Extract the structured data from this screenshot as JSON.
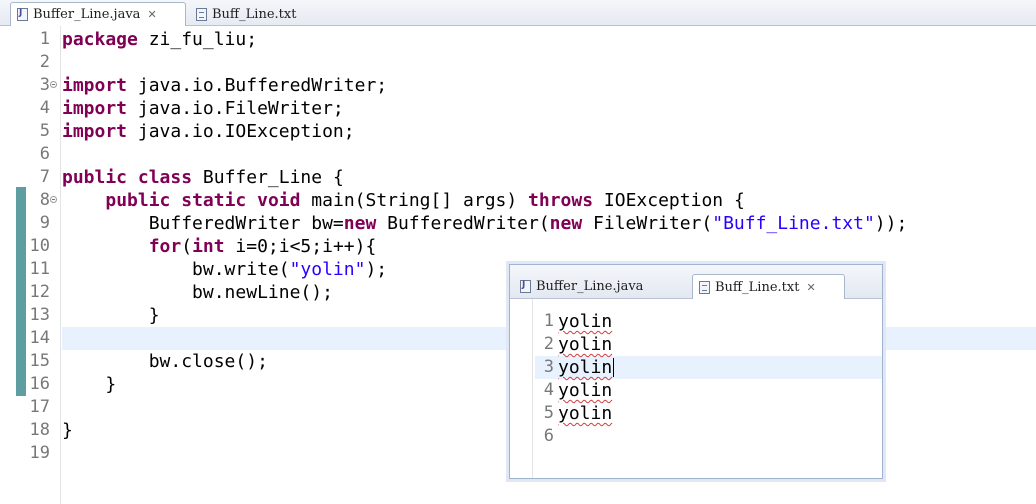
{
  "editor": {
    "tabs": [
      {
        "label": "Buffer_Line.java",
        "active": true,
        "icon": "java-file-icon"
      },
      {
        "label": "Buff_Line.txt",
        "active": false,
        "icon": "text-file-icon"
      }
    ],
    "line_numbers": [
      "1",
      "2",
      "3",
      "4",
      "5",
      "6",
      "7",
      "8",
      "9",
      "10",
      "11",
      "12",
      "13",
      "14",
      "15",
      "16",
      "17",
      "18",
      "19"
    ],
    "current_line": 14,
    "colors": {
      "keyword": "#7f0055",
      "string": "#2a00ff",
      "current_line": "#e8f2fe",
      "change_marker": "#5e9ea0"
    },
    "lines": [
      [
        {
          "k": "kw",
          "t": "package"
        },
        {
          "t": " zi_fu_liu;"
        }
      ],
      [],
      [
        {
          "k": "kw",
          "t": "import"
        },
        {
          "t": " java.io.BufferedWriter;"
        }
      ],
      [
        {
          "k": "kw",
          "t": "import"
        },
        {
          "t": " java.io.FileWriter;"
        }
      ],
      [
        {
          "k": "kw",
          "t": "import"
        },
        {
          "t": " java.io.IOException;"
        }
      ],
      [],
      [
        {
          "k": "kw",
          "t": "public"
        },
        {
          "t": " "
        },
        {
          "k": "kw",
          "t": "class"
        },
        {
          "t": " Buffer_Line {"
        }
      ],
      [
        {
          "t": "    "
        },
        {
          "k": "kw",
          "t": "public"
        },
        {
          "t": " "
        },
        {
          "k": "kw",
          "t": "static"
        },
        {
          "t": " "
        },
        {
          "k": "kw",
          "t": "void"
        },
        {
          "t": " main(String[] args) "
        },
        {
          "k": "kw",
          "t": "throws"
        },
        {
          "t": " IOException {"
        }
      ],
      [
        {
          "t": "        BufferedWriter bw="
        },
        {
          "k": "kw",
          "t": "new"
        },
        {
          "t": " BufferedWriter("
        },
        {
          "k": "kw",
          "t": "new"
        },
        {
          "t": " FileWriter("
        },
        {
          "k": "str",
          "t": "\"Buff_Line.txt\""
        },
        {
          "t": "));"
        }
      ],
      [
        {
          "t": "        "
        },
        {
          "k": "kw",
          "t": "for"
        },
        {
          "t": "("
        },
        {
          "k": "kw",
          "t": "int"
        },
        {
          "t": " i=0;i<5;i++){"
        }
      ],
      [
        {
          "t": "            bw.write("
        },
        {
          "k": "str",
          "t": "\"yolin\""
        },
        {
          "t": ");"
        }
      ],
      [
        {
          "t": "            bw.newLine();"
        }
      ],
      [
        {
          "t": "        }"
        }
      ],
      [],
      [
        {
          "t": "        bw.close();"
        }
      ],
      [
        {
          "t": "    }"
        }
      ],
      [],
      [
        {
          "t": "}"
        }
      ],
      []
    ]
  },
  "txt_window": {
    "tabs": [
      {
        "label": "Buffer_Line.java",
        "active": false,
        "icon": "java-file-icon"
      },
      {
        "label": "Buff_Line.txt",
        "active": true,
        "icon": "text-file-icon"
      }
    ],
    "line_numbers": [
      "1",
      "2",
      "3",
      "4",
      "5",
      "6"
    ],
    "lines": [
      "yolin",
      "yolin",
      "yolin",
      "yolin",
      "yolin",
      ""
    ],
    "current_line": 3
  }
}
